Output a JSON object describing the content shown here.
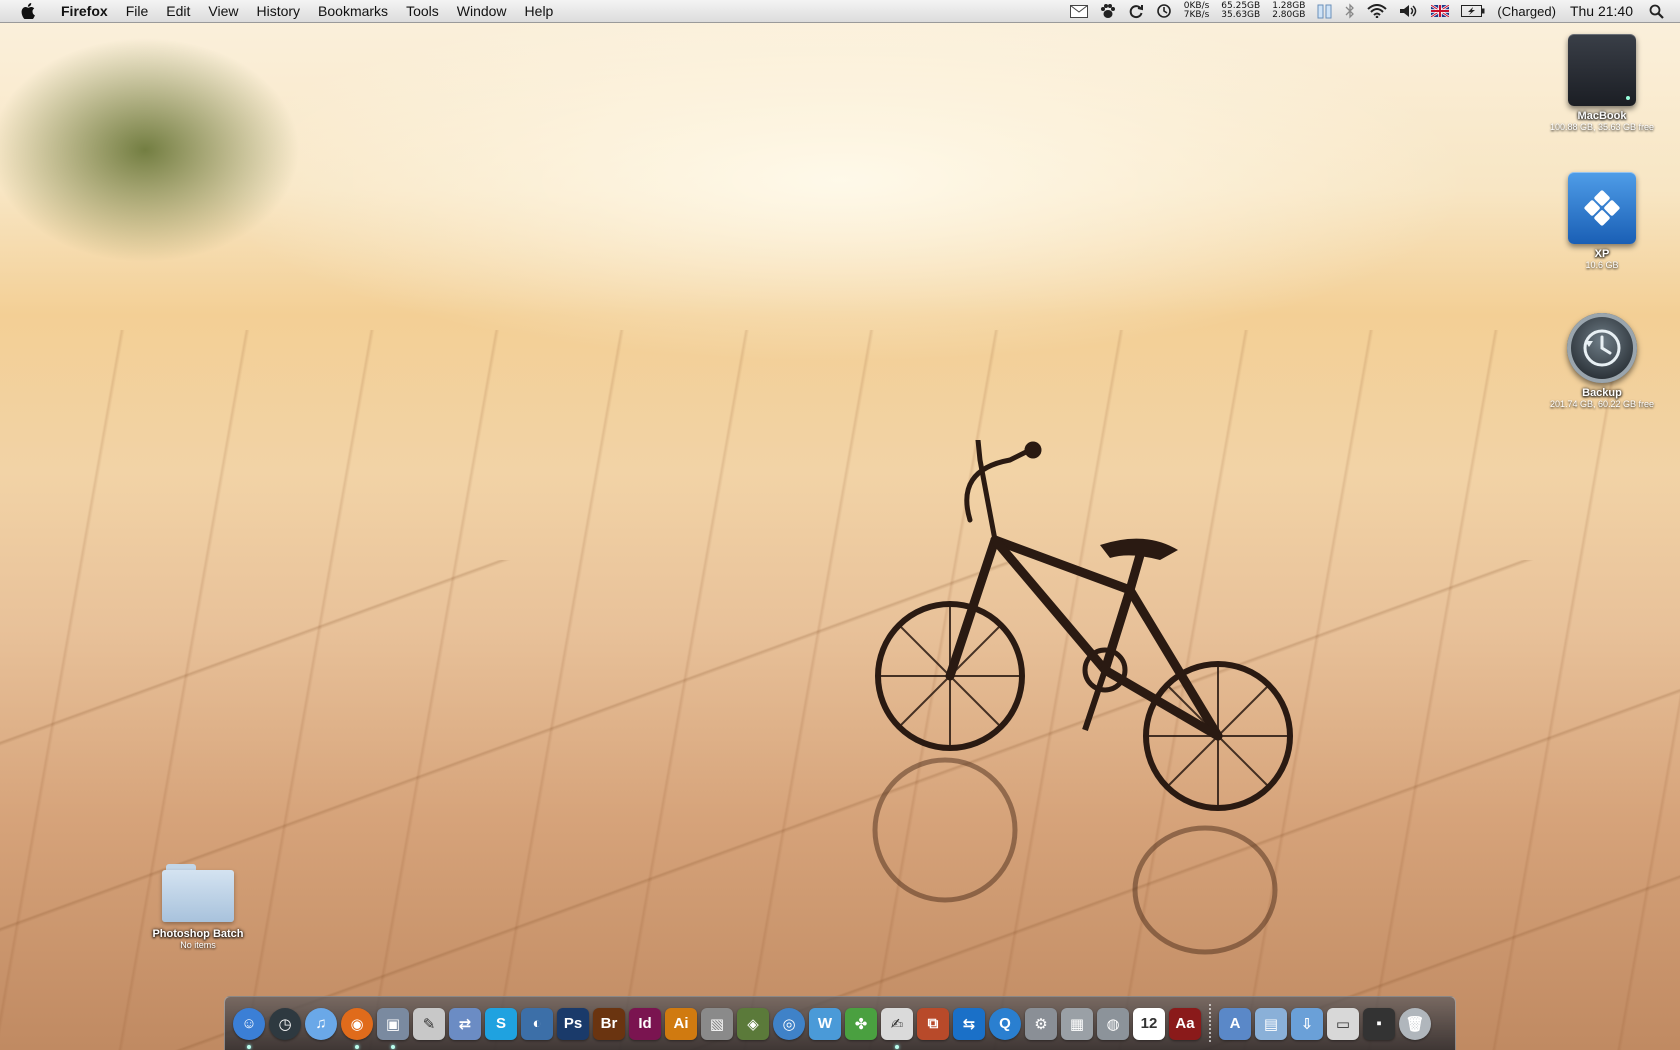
{
  "menubar": {
    "app_name": "Firefox",
    "menus": [
      "File",
      "Edit",
      "View",
      "History",
      "Bookmarks",
      "Tools",
      "Window",
      "Help"
    ],
    "net": {
      "down": "0KB/s",
      "up": "7KB/s"
    },
    "disk": {
      "a": "65.25GB",
      "b": "35.63GB"
    },
    "mem": {
      "a": "1.28GB",
      "b": "2.80GB"
    },
    "battery_status": "(Charged)",
    "clock": "Thu 21:40"
  },
  "desktop_icons": [
    {
      "label": "MacBook",
      "sub": "100.88 GB, 35.63 GB free",
      "icon": "hard-drive-icon"
    },
    {
      "label": "XP",
      "sub": "10.6 GB",
      "icon": "windows-drive-icon"
    },
    {
      "label": "Backup",
      "sub": "201.74 GB, 60.22 GB free",
      "icon": "time-machine-icon"
    }
  ],
  "folder": {
    "label": "Photoshop Batch",
    "sub": "No items"
  },
  "dock": {
    "apps": [
      {
        "name": "finder",
        "text": "☺",
        "color": "#3b7fd6"
      },
      {
        "name": "time-machine",
        "text": "◷",
        "color": "#2e3940"
      },
      {
        "name": "itunes",
        "text": "♫",
        "color": "#6aa8e8"
      },
      {
        "name": "firefox",
        "text": "◉",
        "color": "#e06b1b"
      },
      {
        "name": "preview",
        "text": "▣",
        "color": "#7a8aa0"
      },
      {
        "name": "script-editor",
        "text": "✎",
        "color": "#c8c8c8"
      },
      {
        "name": "transmit",
        "text": "⇄",
        "color": "#6b8cc4"
      },
      {
        "name": "skype",
        "text": "S",
        "color": "#1fa2e0"
      },
      {
        "name": "migration",
        "text": "◐",
        "color": "#3c6fa8"
      },
      {
        "name": "photoshop",
        "text": "Ps",
        "color": "#1a3a6a"
      },
      {
        "name": "bridge",
        "text": "Br",
        "color": "#6a3410"
      },
      {
        "name": "indesign",
        "text": "Id",
        "color": "#7a1450"
      },
      {
        "name": "illustrator",
        "text": "Ai",
        "color": "#d07a10"
      },
      {
        "name": "photos",
        "text": "▧",
        "color": "#8a8a8a"
      },
      {
        "name": "iphoto",
        "text": "◈",
        "color": "#5b7a3a"
      },
      {
        "name": "dvd",
        "text": "◎",
        "color": "#3f82c8"
      },
      {
        "name": "wmp",
        "text": "W",
        "color": "#4a9ad8"
      },
      {
        "name": "leaf",
        "text": "✤",
        "color": "#4aa040"
      },
      {
        "name": "textedit",
        "text": "✍",
        "color": "#dadada"
      },
      {
        "name": "vmware",
        "text": "⧉",
        "color": "#b84a2a"
      },
      {
        "name": "teamviewer",
        "text": "⇆",
        "color": "#1a70c8"
      },
      {
        "name": "quicktime",
        "text": "Q",
        "color": "#2a7fd0"
      },
      {
        "name": "sys-prefs",
        "text": "⚙",
        "color": "#8a8f96"
      },
      {
        "name": "calculator",
        "text": "▦",
        "color": "#9aa0a6"
      },
      {
        "name": "disk-utility",
        "text": "◍",
        "color": "#8c939a"
      },
      {
        "name": "ical",
        "text": "12",
        "color": "#ffffff"
      },
      {
        "name": "dictionary",
        "text": "Aa",
        "color": "#8a1a1a"
      }
    ],
    "stacks": [
      {
        "name": "applications",
        "text": "A",
        "color": "#5a88c8"
      },
      {
        "name": "documents",
        "text": "▤",
        "color": "#8ab0d8"
      },
      {
        "name": "downloads",
        "text": "⇩",
        "color": "#6aa0d8"
      },
      {
        "name": "desktop",
        "text": "▭",
        "color": "#d8d8d8"
      },
      {
        "name": "screenshots",
        "text": "▪",
        "color": "#333333"
      },
      {
        "name": "trash",
        "text": "🗑",
        "color": "#b0b6bc"
      }
    ]
  }
}
